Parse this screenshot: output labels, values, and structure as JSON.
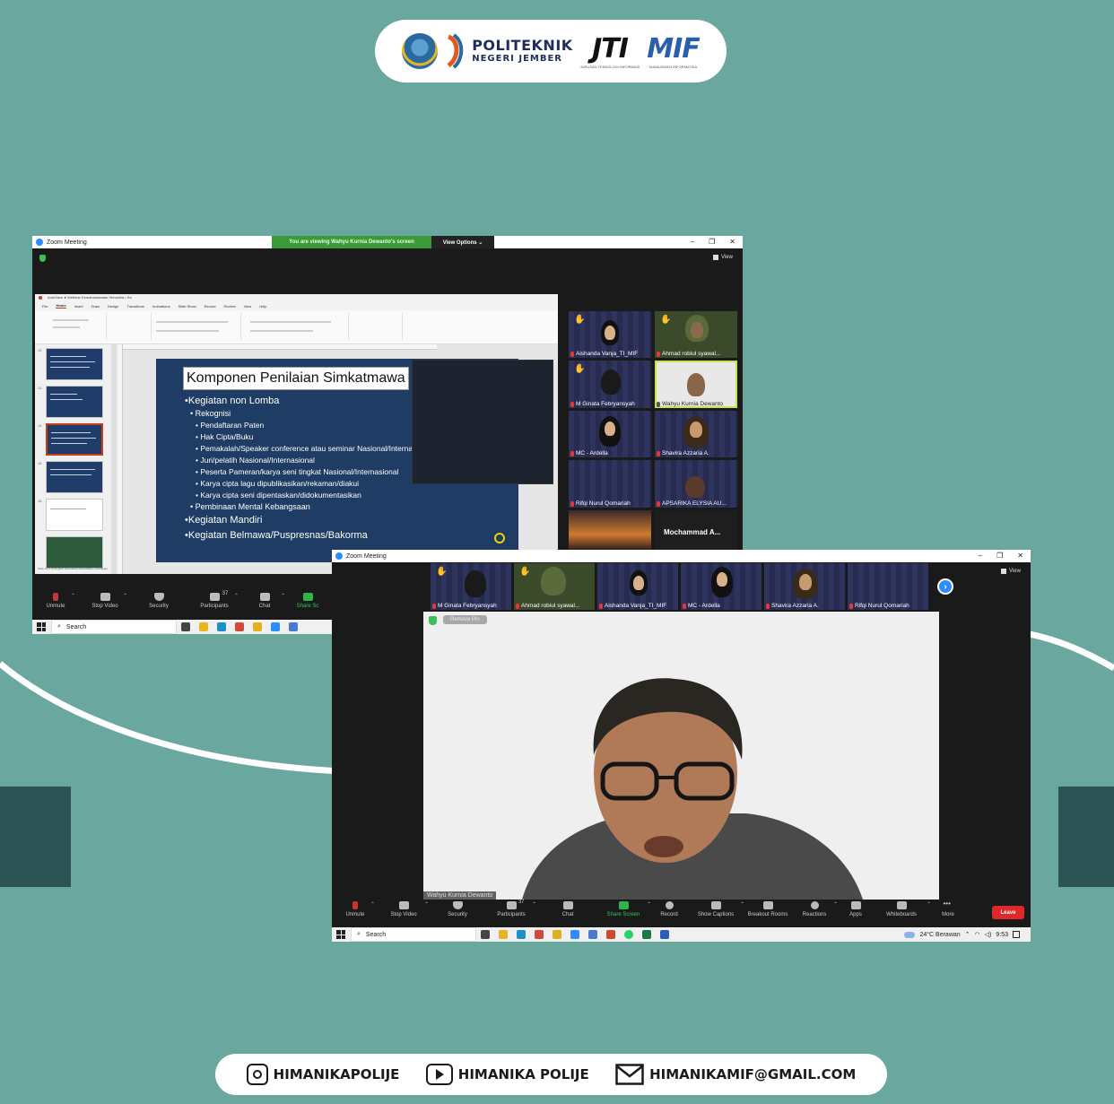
{
  "header": {
    "poli_line1": "POLITEKNIK",
    "poli_line2": "NEGERI JEMBER",
    "jti": "JTI",
    "jti_sub": "JURUSAN TEKNOLOGI INFORMASI",
    "mif": "MIF",
    "mif_sub": "MANAJEMEN INFORMATIKA"
  },
  "window1": {
    "title": "Zoom Meeting",
    "viewing_text": "You are viewing Wahyu Kurnia Dewanto's screen",
    "view_options": "View Options ⌄",
    "view_label": "View",
    "ppt": {
      "title": "AutoSave  ●  Webinar Kemahasiswaan Himanika • Sa",
      "tabs": [
        "File",
        "Home",
        "Insert",
        "Draw",
        "Design",
        "Transitions",
        "Animations",
        "Slide Show",
        "Record",
        "Review",
        "View",
        "Help"
      ],
      "status": "Slide 14 of 16   English (Indonesia)   Accessibility: Investigate"
    },
    "slide": {
      "title": "Komponen Penilaian Simkatmawa",
      "lines": [
        "•Kegiatan non Lomba",
        "• Rekognisi",
        "• Pendaftaran Paten",
        "• Hak Cipta/Buku",
        "• Pemakalah/Speaker conference atau seminar Nasional/Internasional",
        "• Juri/pelatih Nasional/Internasional",
        "• Peserta Pameran/karya seni tingkat Nasional/Internasional",
        "• Karya cipta lagu dipublikasikan/rekaman/diakui",
        "• Karya cipta seni dipentaskan/didokumentasikan",
        "• Pembinaan Mental Kebangsaan",
        "•Kegiatan Mandiri",
        "•Kegiatan Belmawa/Puspresnas/Bakorma"
      ],
      "page_badge": "14"
    },
    "participants": [
      {
        "name": "Aishanda Vanja_TI_MIF"
      },
      {
        "name": "Ahmad robiul syawal..."
      },
      {
        "name": "M Ginata Febryansyah"
      },
      {
        "name": "Wahyu Kurnia Dewanto"
      },
      {
        "name": "MC - Ardella"
      },
      {
        "name": "Shavira Azzaria A."
      },
      {
        "name": "Rifqi Nurul Qomariah"
      },
      {
        "name": "APSARIKA ELYSIA AU..."
      },
      {
        "name": ""
      },
      {
        "name": "Mochammad A..."
      }
    ],
    "toolbar": {
      "unmute": "Unmute",
      "stop_video": "Stop Video",
      "security": "Security",
      "participants": "Participants",
      "participants_count": "37",
      "chat": "Chat",
      "share": "Share Sc"
    },
    "taskbar": {
      "search": "Search"
    }
  },
  "window2": {
    "title": "Zoom Meeting",
    "view_label": "View",
    "strip": [
      {
        "name": "M Ginata Febryansyah"
      },
      {
        "name": "Ahmad robiul syawal..."
      },
      {
        "name": "Aishanda Vanja_TI_MIF"
      },
      {
        "name": "MC - Ardella"
      },
      {
        "name": "Shavira Azzaria A."
      },
      {
        "name": "Rifqi Nurul Qomariah"
      }
    ],
    "remove_pin": "Remove Pin",
    "main_speaker": "Wahyu Kurnia Dewanto",
    "toolbar": {
      "unmute": "Unmute",
      "stop_video": "Stop Video",
      "security": "Security",
      "participants": "Participants",
      "participants_count": "37",
      "chat": "Chat",
      "share_screen": "Share Screen",
      "record": "Record",
      "show_captions": "Show Captions",
      "breakout_rooms": "Breakout Rooms",
      "reactions": "Reactions",
      "apps": "Apps",
      "whiteboards": "Whiteboards",
      "more": "More",
      "leave": "Leave"
    },
    "taskbar": {
      "search": "Search",
      "weather": "24°C  Berawan",
      "time": "9:53"
    }
  },
  "footer": {
    "instagram": "HIMANIKAPOLIJE",
    "youtube": "HIMANIKA POLIJE",
    "email": "HIMANIKAMIF@GMAIL.COM"
  },
  "colors": {
    "background": "#6aa89f",
    "dark_block": "#2e5354",
    "zoom_green": "#2fb34a",
    "zoom_blue": "#2d8cff",
    "leave_red": "#e02828",
    "slide_bg": "#1f3d64"
  }
}
